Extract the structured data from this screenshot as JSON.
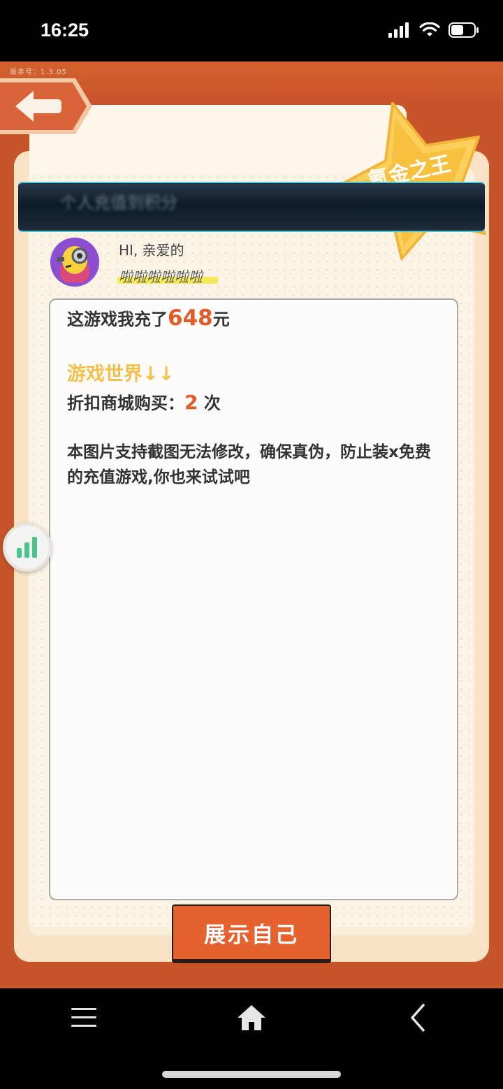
{
  "status_bar": {
    "time": "16:25"
  },
  "app": {
    "version_label": "版本号：1.3.05",
    "badge_text": "氪金之王",
    "blurred_banner_text": "个人充值到积分"
  },
  "profile": {
    "greeting": "HI, 亲爱的",
    "username": "啦啦啦啦啦啦"
  },
  "message": {
    "line1_prefix": "这游戏我充了",
    "amount": "648",
    "line1_suffix": "元",
    "world_label": "游戏世界↓↓",
    "mall_prefix": "折扣商城购买：",
    "mall_count": "2",
    "mall_suffix": " 次",
    "notice": "本图片支持截图无法修改，确保真伪，防止装x免费的充值游戏,你也来试试吧"
  },
  "actions": {
    "show_button": "展示自己"
  },
  "colors": {
    "accent": "#e5622f",
    "highlight": "#f4c04a",
    "amount": "#e35a28",
    "background": "#c8542a"
  },
  "icons": [
    "back-arrow-icon",
    "signal-icon",
    "wifi-icon",
    "battery-icon",
    "bar-chart-icon",
    "menu-icon",
    "home-icon",
    "chevron-left-icon"
  ]
}
